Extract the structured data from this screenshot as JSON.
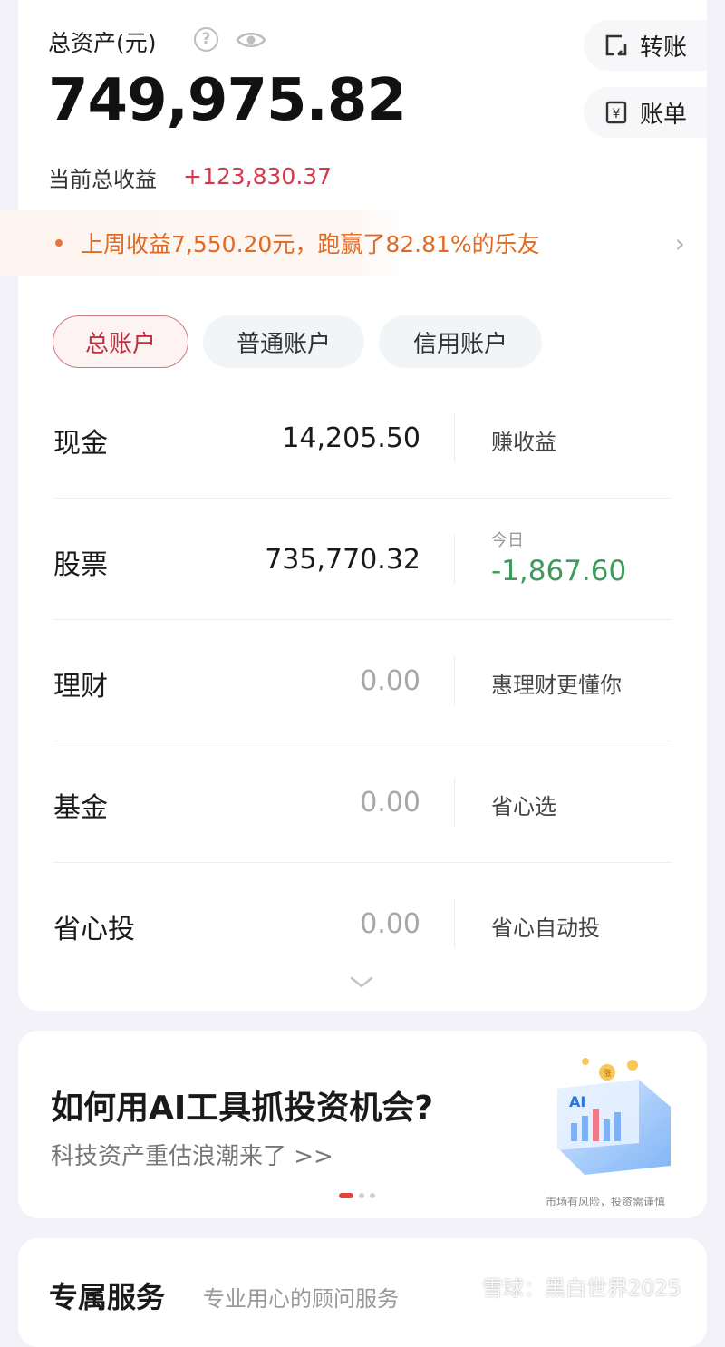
{
  "header": {
    "total_label": "总资产(元)",
    "total_amount": "749,975.82",
    "income_label": "当前总收益",
    "income_value": "+123,830.37"
  },
  "actions": {
    "transfer": "转账",
    "bill": "账单"
  },
  "banner": {
    "text": "上周收益7,550.20元，跑赢了82.81%的乐友"
  },
  "tabs": [
    {
      "label": "总账户",
      "active": true
    },
    {
      "label": "普通账户",
      "active": false
    },
    {
      "label": "信用账户",
      "active": false
    }
  ],
  "rows": [
    {
      "name": "现金",
      "value": "14,205.50",
      "side": "赚收益"
    },
    {
      "name": "股票",
      "value": "735,770.32",
      "side_sub": "今日",
      "side": "-1,867.60"
    },
    {
      "name": "理财",
      "value": "0.00",
      "side": "惠理财更懂你"
    },
    {
      "name": "基金",
      "value": "0.00",
      "side": "省心选"
    },
    {
      "name": "省心投",
      "value": "0.00",
      "side": "省心自动投"
    }
  ],
  "promo": {
    "title": "如何用AI工具抓投资机会?",
    "subtitle": "科技资产重估浪潮来了 >>",
    "art_label": "AI",
    "art_badge": "涨",
    "risk_note": "市场有风险，投资需谨慎",
    "active_dot": 0,
    "dot_count": 3
  },
  "service": {
    "title": "专属服务",
    "subtitle": "专业用心的顾问服务"
  },
  "watermark": "雪球：黑白世界2025",
  "colors": {
    "accent_red": "#d2394b",
    "orange": "#e06a24",
    "negative_green": "#3f9a5b"
  }
}
